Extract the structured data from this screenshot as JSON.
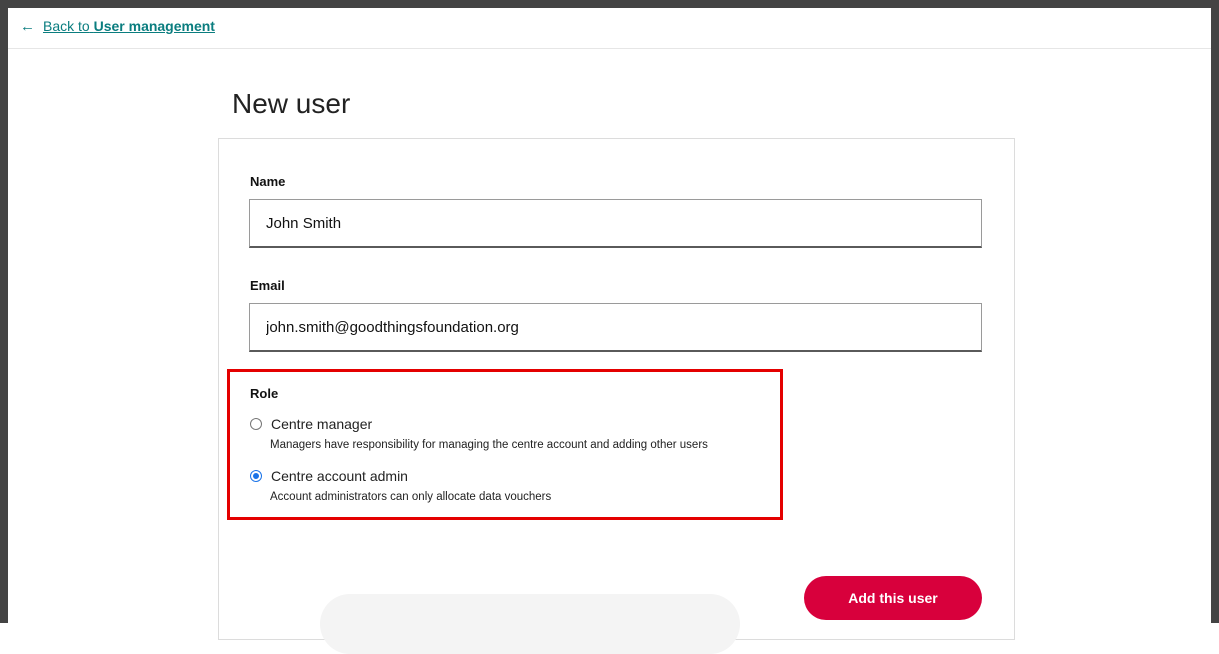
{
  "back_link": {
    "prefix": "Back to",
    "target": "User management"
  },
  "page": {
    "title": "New user"
  },
  "form": {
    "name": {
      "label": "Name",
      "value": "John Smith"
    },
    "email": {
      "label": "Email",
      "value": "john.smith@goodthingsfoundation.org"
    },
    "role": {
      "label": "Role",
      "options": [
        {
          "label": "Centre manager",
          "hint": "Managers have responsibility for managing the centre account and adding other users",
          "selected": false
        },
        {
          "label": "Centre account admin",
          "hint": "Account administrators can only allocate data vouchers",
          "selected": true
        }
      ]
    },
    "submit_label": "Add this user"
  },
  "colors": {
    "link": "#0a7d7f",
    "primary": "#d8003c",
    "highlight": "#e40000",
    "radio_selected": "#1a73e8"
  },
  "icons": {
    "back": "arrow-left-icon"
  }
}
